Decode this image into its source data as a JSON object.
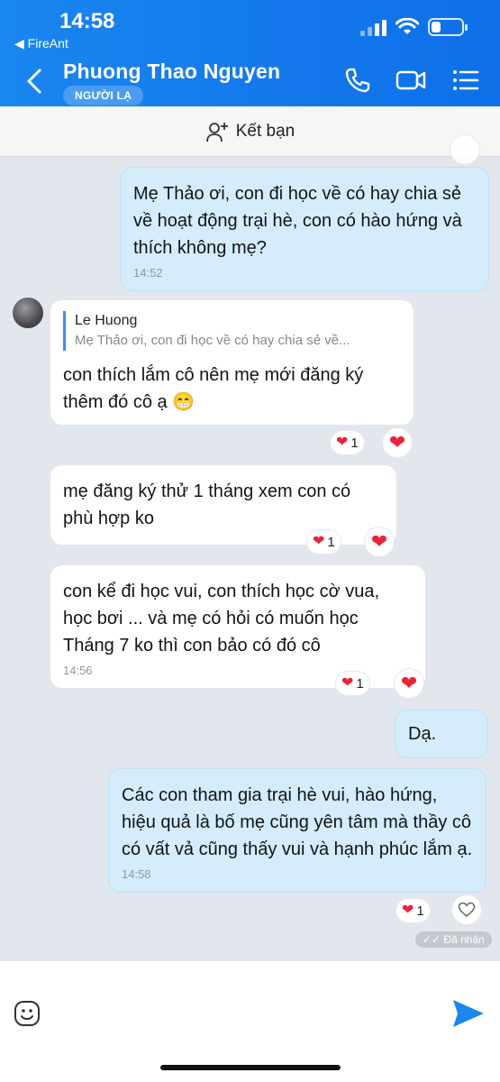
{
  "status": {
    "time": "14:58",
    "back_app": "◀ FireAnt",
    "battery_level": 0.3
  },
  "header": {
    "name": "Phuong Thao Nguyen",
    "badge": "NGƯỜI LẠ"
  },
  "friend_bar": {
    "label": "Kết bạn"
  },
  "messages": [
    {
      "text": "Mẹ Thảo ơi, con đi học về có hay chia sẻ về hoạt động trại hè, con có hào hứng và thích không mẹ?",
      "time": "14:52"
    },
    {
      "quote_name": "Le Huong",
      "quote_text": "Mẹ Thảo ơi, con đi học về có hay chia sẻ về...",
      "text": "con thích lắm cô nên mẹ mới đăng ký thêm đó cô ạ 😁",
      "reaction_count": "1"
    },
    {
      "text": "mẹ đăng ký thử 1 tháng xem con có phù hợp ko",
      "reaction_count": "1"
    },
    {
      "text": "con kể đi học vui, con thích học cờ vua, học bơi ... và mẹ có hỏi có muốn học Tháng 7 ko thì con bảo có đó cô",
      "time": "14:56",
      "reaction_count": "1"
    },
    {
      "text": "Dạ."
    },
    {
      "text": "Các con tham gia trại hè vui, hào hứng, hiệu quả là bố mẹ cũng yên tâm mà thầy cô có vất vả cũng thấy vui và hạnh phúc lắm ạ.",
      "time": "14:58",
      "reaction_count": "1",
      "status": "Đã nhận"
    }
  ],
  "icons": {
    "reaction": "heart-icon",
    "accent": "#1a86f0",
    "heart_color": "#e8233a"
  }
}
